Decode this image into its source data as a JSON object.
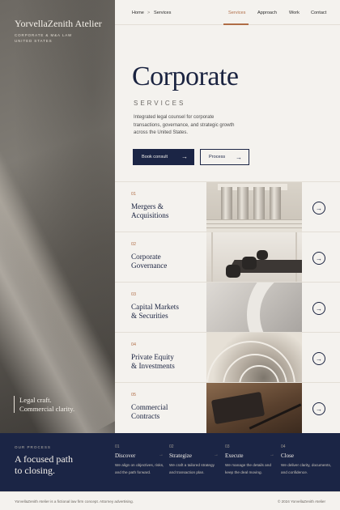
{
  "brand": {
    "name": "YorvellaZenith Atelier",
    "sub_line1": "CORPORATE & M&A LAW",
    "sub_line2": "UNITED STATES",
    "tagline_line1": "Legal craft.",
    "tagline_line2": "Commercial clarity."
  },
  "breadcrumb": {
    "home": "Home",
    "separator": ">",
    "current": "Services"
  },
  "menu": [
    {
      "label": "Services",
      "active": true
    },
    {
      "label": "Approach",
      "active": false
    },
    {
      "label": "Work",
      "active": false
    },
    {
      "label": "Contact",
      "active": false
    }
  ],
  "hero": {
    "title": "Corporate",
    "subtitle": "SERVICES",
    "description": "Integrated legal counsel for corporate transactions, governance, and strategic growth across the United States.",
    "primary_button": "Book consult",
    "secondary_button": "Process",
    "arrow": "→"
  },
  "services": [
    {
      "num": "01",
      "line1": "Mergers &",
      "line2": "Acquisitions",
      "image": "columns"
    },
    {
      "num": "02",
      "line1": "Corporate",
      "line2": "Governance",
      "image": "boardroom"
    },
    {
      "num": "03",
      "line1": "Capital Markets",
      "line2": "& Securities",
      "image": "curve"
    },
    {
      "num": "04",
      "line1": "Private Equity",
      "line2": "& Investments",
      "image": "staircase"
    },
    {
      "num": "05",
      "line1": "Commercial",
      "line2": "Contracts",
      "image": "desk"
    }
  ],
  "process": {
    "label": "OUR PROCESS",
    "heading_line1": "A focused path",
    "heading_line2": "to closing.",
    "steps": [
      {
        "num": "01",
        "title": "Discover",
        "desc": "We align on objectives, risks, and the path forward."
      },
      {
        "num": "02",
        "title": "Strategize",
        "desc": "We craft a tailored strategy and transaction plan."
      },
      {
        "num": "03",
        "title": "Execute",
        "desc": "We manage the details and keep the deal moving."
      },
      {
        "num": "04",
        "title": "Close",
        "desc": "We deliver clarity, documents, and confidence."
      }
    ]
  },
  "footer": {
    "left": "YorvellaZenith Atelier is a fictional law firm concept. Attorney advertising.",
    "right": "© 2024 YorvellaZenith Atelier"
  }
}
